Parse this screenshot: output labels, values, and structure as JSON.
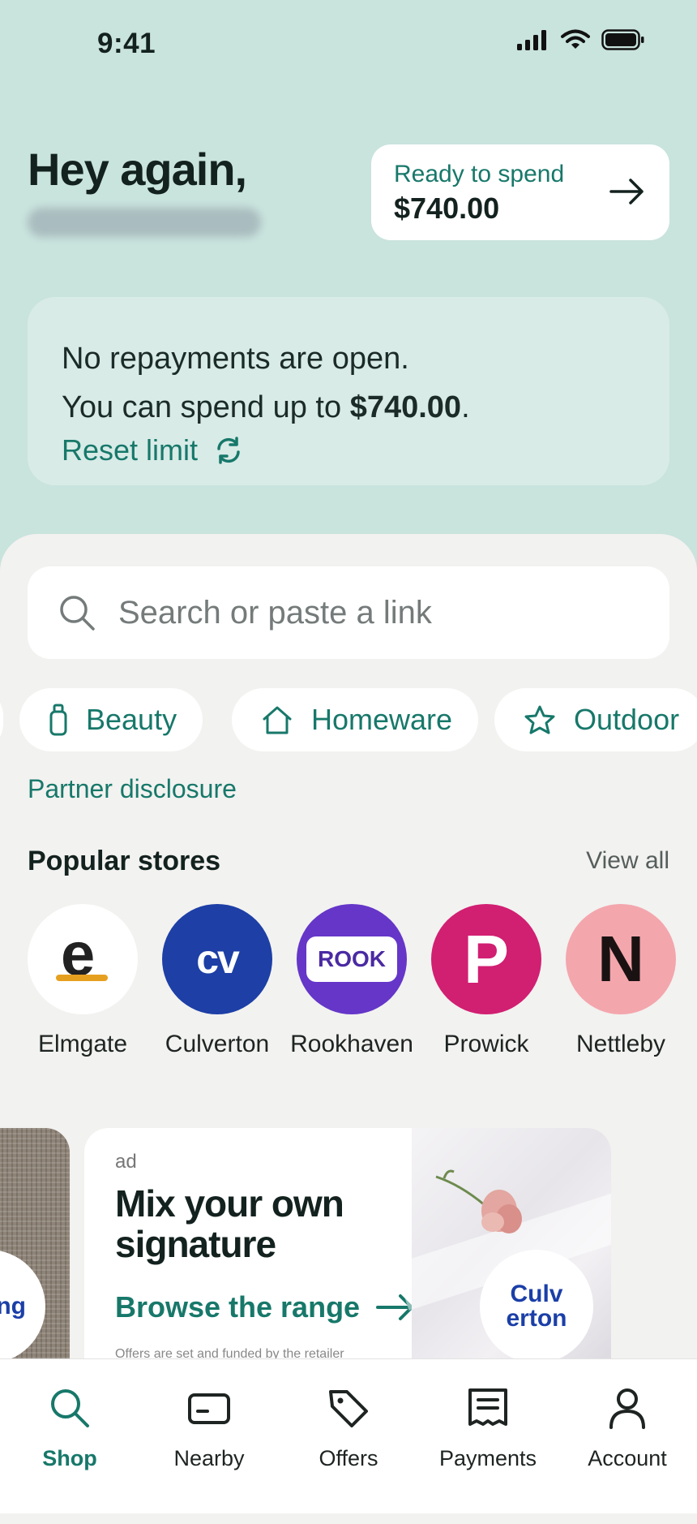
{
  "status_bar": {
    "time": "9:41",
    "icons": [
      "signal-icon",
      "wifi-icon",
      "battery-icon"
    ]
  },
  "header": {
    "greeting": "Hey again,"
  },
  "spend_card": {
    "label": "Ready to spend",
    "amount": "$740.00"
  },
  "info_card": {
    "line1": "No repayments are open.",
    "line2_prefix": "You can spend up to ",
    "line2_amount": "$740.00",
    "line2_suffix": ".",
    "reset_label": "Reset limit"
  },
  "search": {
    "placeholder": "Search or paste a link"
  },
  "categories": [
    {
      "label": "Beauty",
      "icon": "bottle-icon"
    },
    {
      "label": "Homeware",
      "icon": "house-icon"
    },
    {
      "label": "Outdoor",
      "icon": "star-icon"
    }
  ],
  "partner_disclosure": "Partner disclosure",
  "popular_stores": {
    "title": "Popular stores",
    "view_all": "View all",
    "stores": [
      {
        "name": "Elmgate",
        "logo_text": "e",
        "color": "#ffffff"
      },
      {
        "name": "Culverton",
        "logo_text": "cv",
        "color": "#1d3fa6"
      },
      {
        "name": "Rookhaven",
        "logo_text": "ROOK",
        "color": "#6536c8"
      },
      {
        "name": "Prowick",
        "logo_text": "P",
        "color": "#d11f72"
      },
      {
        "name": "Nettleby",
        "logo_text": "N",
        "color": "#f4a6ad"
      }
    ]
  },
  "promo_left": {
    "badge_text": "ring"
  },
  "promo": {
    "ad_label": "ad",
    "headline": "Mix your own signature",
    "cta": "Browse the range",
    "fine_print": "Offers are set and funded by the retailer",
    "badge_text": "Culv erton"
  },
  "tabbar": {
    "tabs": [
      {
        "label": "Shop",
        "icon": "search-icon",
        "active": true
      },
      {
        "label": "Nearby",
        "icon": "card-icon"
      },
      {
        "label": "Offers",
        "icon": "tag-icon"
      },
      {
        "label": "Payments",
        "icon": "receipt-icon"
      },
      {
        "label": "Account",
        "icon": "person-icon"
      }
    ]
  },
  "colors": {
    "accent": "#17786a",
    "header_bg": "#c9e3dd",
    "sheet_bg": "#f2f2f0"
  }
}
